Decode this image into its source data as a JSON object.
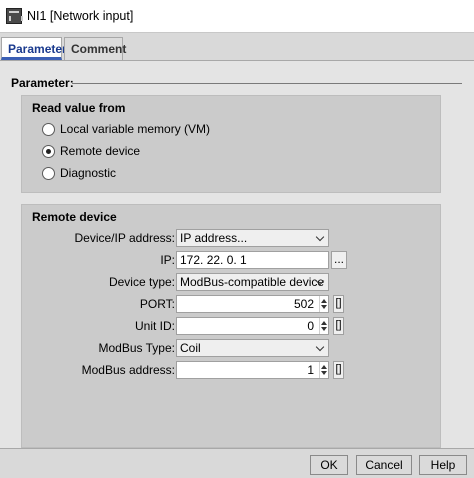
{
  "window": {
    "title": "NI1 [Network input]",
    "icon": "network-input-icon"
  },
  "tabs": [
    {
      "label": "Parameter",
      "active": true
    },
    {
      "label": "Comment",
      "active": false
    }
  ],
  "parameter": {
    "header": "Parameter:",
    "read_value": {
      "title": "Read value from",
      "options": [
        {
          "label": "Local variable memory (VM)",
          "selected": false
        },
        {
          "label": "Remote device",
          "selected": true
        },
        {
          "label": "Diagnostic",
          "selected": false
        }
      ]
    },
    "remote_device": {
      "title": "Remote device",
      "device_ip_address": {
        "label": "Device/IP address:",
        "value": "IP address..."
      },
      "ip": {
        "label": "IP:",
        "value": "172. 22.  0.  1",
        "button": "..."
      },
      "device_type": {
        "label": "Device type:",
        "value": "ModBus-compatible device"
      },
      "port": {
        "label": "PORT:",
        "value": "502",
        "button": "[]"
      },
      "unit_id": {
        "label": "Unit ID:",
        "value": "0",
        "button": "[]"
      },
      "modbus_type": {
        "label": "ModBus Type:",
        "value": "Coil"
      },
      "modbus_address": {
        "label": "ModBus address:",
        "value": "1",
        "button": "[]"
      }
    }
  },
  "buttons": {
    "ok": "OK",
    "cancel": "Cancel",
    "help": "Help"
  }
}
